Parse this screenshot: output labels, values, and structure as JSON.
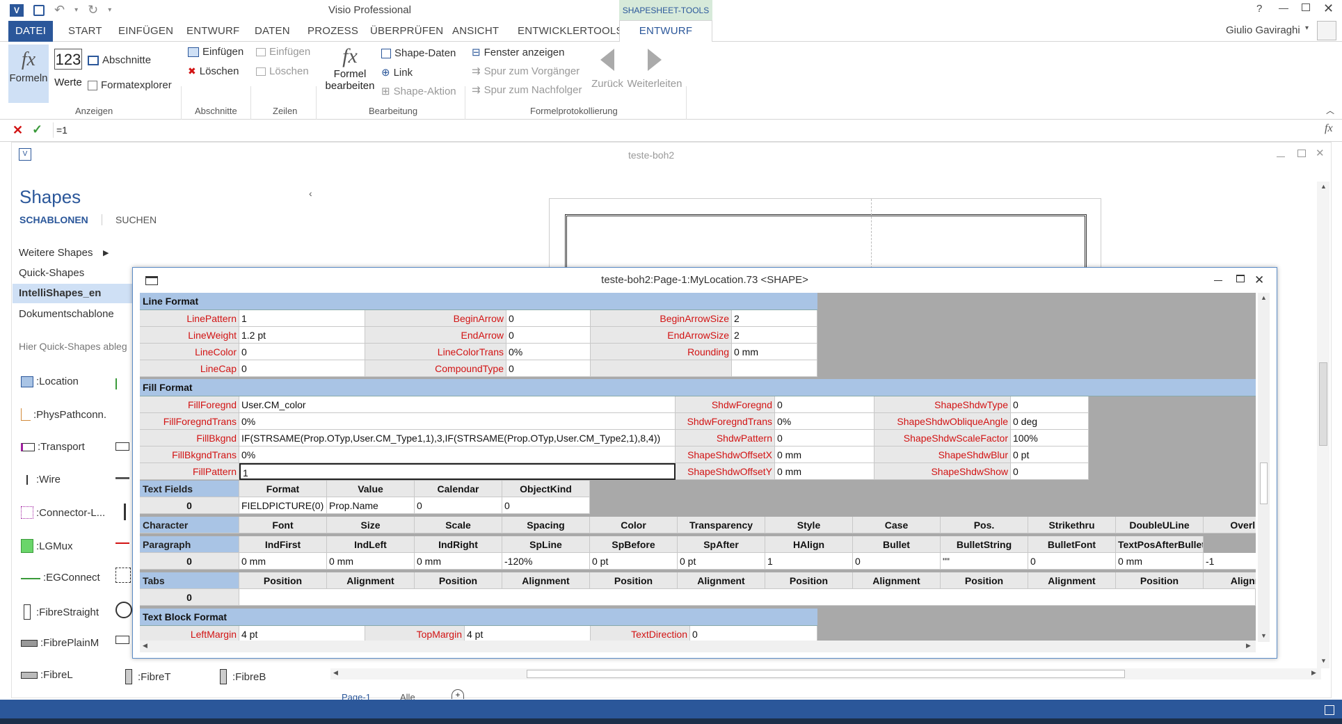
{
  "app": {
    "title": "Visio Professional",
    "help": "?",
    "user": "Giulio Gaviraghi"
  },
  "ribbon_tabs": [
    "DATEI",
    "START",
    "EINFÜGEN",
    "ENTWURF",
    "DATEN",
    "PROZESS",
    "ÜBERPRÜFEN",
    "ANSICHT",
    "ENTWICKLERTOOLS",
    "ENTWURF"
  ],
  "context_tab": "SHAPESHEET-TOOLS",
  "ribbon": {
    "formeln": "Formeln",
    "werte": "Werte",
    "werte_icon": "123",
    "abschnitte": "Abschnitte",
    "formatexplorer": "Formatexplorer",
    "einfuegen": "Einfügen",
    "loeschen": "Löschen",
    "zeilen_einfuegen": "Einfügen",
    "zeilen_loeschen": "Löschen",
    "formel1": "Formel",
    "formel2": "bearbeiten",
    "shape_daten": "Shape-Daten",
    "link": "Link",
    "shape_aktion": "Shape-Aktion",
    "fenster": "Fenster anzeigen",
    "vorgaenger": "Spur zum Vorgänger",
    "nachfolger": "Spur zum Nachfolger",
    "zurueck": "Zurück",
    "weiterleiten": "Weiterleiten",
    "groups": [
      "Anzeigen",
      "Abschnitte",
      "Zeilen",
      "Bearbeitung",
      "Formelprotokollierung"
    ]
  },
  "formula_bar": {
    "value": "=1",
    "fx": "fx"
  },
  "document": {
    "title": "teste-boh2"
  },
  "shapes_pane": {
    "title": "Shapes",
    "tab_schablonen": "SCHABLONEN",
    "tab_suchen": "SUCHEN",
    "items": [
      "Weitere Shapes",
      "Quick-Shapes",
      "IntelliShapes_en",
      "Dokumentschablone"
    ],
    "hint": "Hier Quick-Shapes ableg",
    "stencils": [
      ":Location",
      ":PhysPathconn.",
      ":Transport",
      ":Wire",
      ":Connector-L...",
      ":LGMux",
      ":EGConnect",
      ":FibreStraight",
      ":FibrePlainM",
      ":FibreL",
      ":FibreT",
      ":FibreB"
    ]
  },
  "page_tabs": {
    "page": "Page-1",
    "all": "Alle"
  },
  "shapesheet": {
    "title": "teste-boh2:Page-1:MyLocation.73 <SHAPE>",
    "line_format": {
      "title": "Line Format",
      "rows": [
        [
          [
            "LinePattern",
            "1"
          ],
          [
            "BeginArrow",
            "0"
          ],
          [
            "BeginArrowSize",
            "2"
          ]
        ],
        [
          [
            "LineWeight",
            "1.2 pt"
          ],
          [
            "EndArrow",
            "0"
          ],
          [
            "EndArrowSize",
            "2"
          ]
        ],
        [
          [
            "LineColor",
            "0"
          ],
          [
            "LineColorTrans",
            "0%"
          ],
          [
            "Rounding",
            "0 mm"
          ]
        ],
        [
          [
            "LineCap",
            "0"
          ],
          [
            "CompoundType",
            "0"
          ],
          [
            "",
            ""
          ]
        ]
      ]
    },
    "fill_format": {
      "title": "Fill Format",
      "rows": [
        [
          [
            "FillForegnd",
            "User.CM_color"
          ],
          [
            "ShdwForegnd",
            "0"
          ],
          [
            "ShapeShdwType",
            "0"
          ]
        ],
        [
          [
            "FillForegndTrans",
            "0%"
          ],
          [
            "ShdwForegndTrans",
            "0%"
          ],
          [
            "ShapeShdwObliqueAngle",
            "0 deg"
          ]
        ],
        [
          [
            "FillBkgnd",
            "IF(STRSAME(Prop.OTyp,User.CM_Type1,1),3,IF(STRSAME(Prop.OTyp,User.CM_Type2,1),8,4))"
          ],
          [
            "ShdwPattern",
            "0"
          ],
          [
            "ShapeShdwScaleFactor",
            "100%"
          ]
        ],
        [
          [
            "FillBkgndTrans",
            "0%"
          ],
          [
            "ShapeShdwOffsetX",
            "0 mm"
          ],
          [
            "ShapeShdwBlur",
            "0 pt"
          ]
        ],
        [
          [
            "FillPattern",
            "1"
          ],
          [
            "ShapeShdwOffsetY",
            "0 mm"
          ],
          [
            "ShapeShdwShow",
            "0"
          ]
        ]
      ]
    },
    "text_fields": {
      "title": "Text Fields",
      "headers": [
        "Format",
        "Value",
        "Calendar",
        "ObjectKind"
      ],
      "row_index": "0",
      "values": [
        "FIELDPICTURE(0)",
        "Prop.Name",
        "0",
        "0"
      ]
    },
    "character": {
      "title": "Character",
      "headers": [
        "Font",
        "Size",
        "Scale",
        "Spacing",
        "Color",
        "Transparency",
        "Style",
        "Case",
        "Pos.",
        "Strikethru",
        "DoubleULine",
        "Overlin"
      ]
    },
    "paragraph": {
      "title": "Paragraph",
      "headers": [
        "IndFirst",
        "IndLeft",
        "IndRight",
        "SpLine",
        "SpBefore",
        "SpAfter",
        "HAlign",
        "Bullet",
        "BulletString",
        "BulletFont",
        "TextPosAfterBullet"
      ],
      "row_index": "0",
      "values": [
        "0 mm",
        "0 mm",
        "0 mm",
        "-120%",
        "0 pt",
        "0 pt",
        "1",
        "0",
        "\"\"",
        "0",
        "0 mm",
        "-1"
      ]
    },
    "tabs": {
      "title": "Tabs",
      "headers": [
        "Position",
        "Alignment",
        "Position",
        "Alignment",
        "Position",
        "Alignment",
        "Position",
        "Alignment",
        "Position",
        "Alignment",
        "Position",
        "Alignm"
      ],
      "row_index": "0"
    },
    "text_block": {
      "title": "Text Block Format",
      "row": [
        [
          "LeftMargin",
          "4 pt"
        ],
        [
          "TopMargin",
          "4 pt"
        ],
        [
          "TextDirection",
          "0"
        ]
      ]
    }
  }
}
